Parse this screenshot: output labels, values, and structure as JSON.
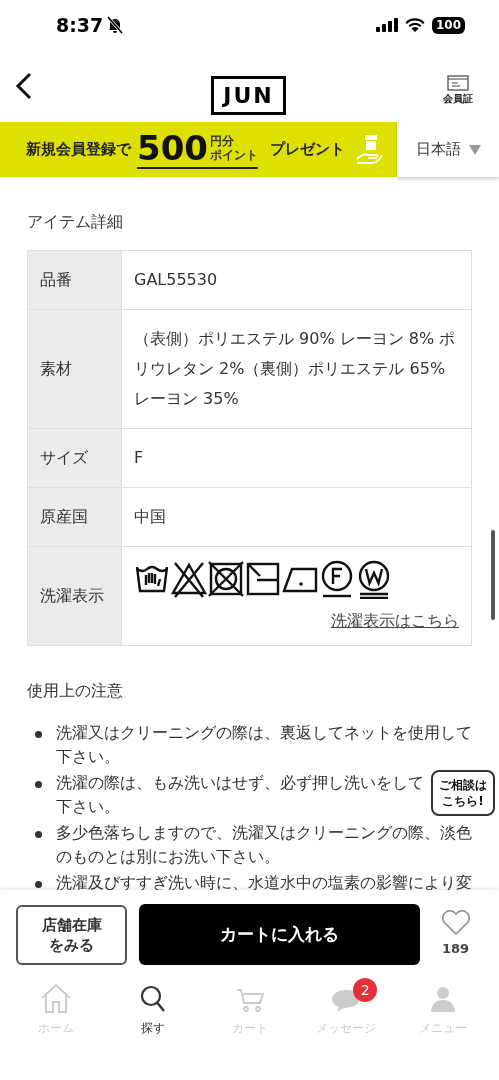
{
  "status_bar": {
    "time": "8:37",
    "battery": "100"
  },
  "header": {
    "logo": "JUN",
    "member_card": "会員証"
  },
  "banner": {
    "lead": "新規会員登録で",
    "amount": "500",
    "unit_top": "円分",
    "unit_bottom": "ポイント",
    "tail": "プレゼント",
    "language": "日本語"
  },
  "details": {
    "title": "アイテム詳細",
    "rows": [
      {
        "kind": "text",
        "label": "品番",
        "value": "GAL55530"
      },
      {
        "kind": "text",
        "label": "素材",
        "value": "（表側）ポリエステル 90% レーヨン 8% ポリウレタン 2%（裏側）ポリエステル 65% レーヨン 35%"
      },
      {
        "kind": "text",
        "label": "サイズ",
        "value": "F"
      },
      {
        "kind": "text",
        "label": "原産国",
        "value": "中国"
      },
      {
        "kind": "care",
        "label": "洗濯表示",
        "symbols": [
          {
            "kind": "hand-wash"
          },
          {
            "kind": "no-bleach"
          },
          {
            "kind": "no-tumble-dry"
          },
          {
            "kind": "flat-dry-shade"
          },
          {
            "kind": "iron-low"
          },
          {
            "kind": "dry-clean-f"
          },
          {
            "kind": "wet-clean-w"
          }
        ],
        "link": "洗濯表示はこちら"
      }
    ]
  },
  "notes": {
    "title": "使用上の注意",
    "items": [
      "洗濯又はクリーニングの際は、裏返してネットを使用して下さい。",
      "洗濯の際は、もみ洗いはせず、必ず押し洗いをして下さい。",
      "多少色落ちしますので、洗濯又はクリーニングの際、淡色のものとは別にお洗い下さい。",
      "洗濯及びすすぎ洗い時に、水道水中の塩素の影響により変"
    ]
  },
  "chat_bubble": [
    "ご相談は",
    "こちら!"
  ],
  "actions": {
    "store_stock": [
      "店舗在庫",
      "をみる"
    ],
    "cart": "カートに入れる",
    "favorites": "189"
  },
  "tabs": [
    {
      "kind": "home",
      "label": "ホーム",
      "selected": false
    },
    {
      "kind": "search",
      "label": "探す",
      "selected": true
    },
    {
      "kind": "cart",
      "label": "カート",
      "selected": false
    },
    {
      "kind": "message",
      "label": "メッセージ",
      "selected": false,
      "badge": "2"
    },
    {
      "kind": "person",
      "label": "メニュー",
      "selected": false
    }
  ]
}
